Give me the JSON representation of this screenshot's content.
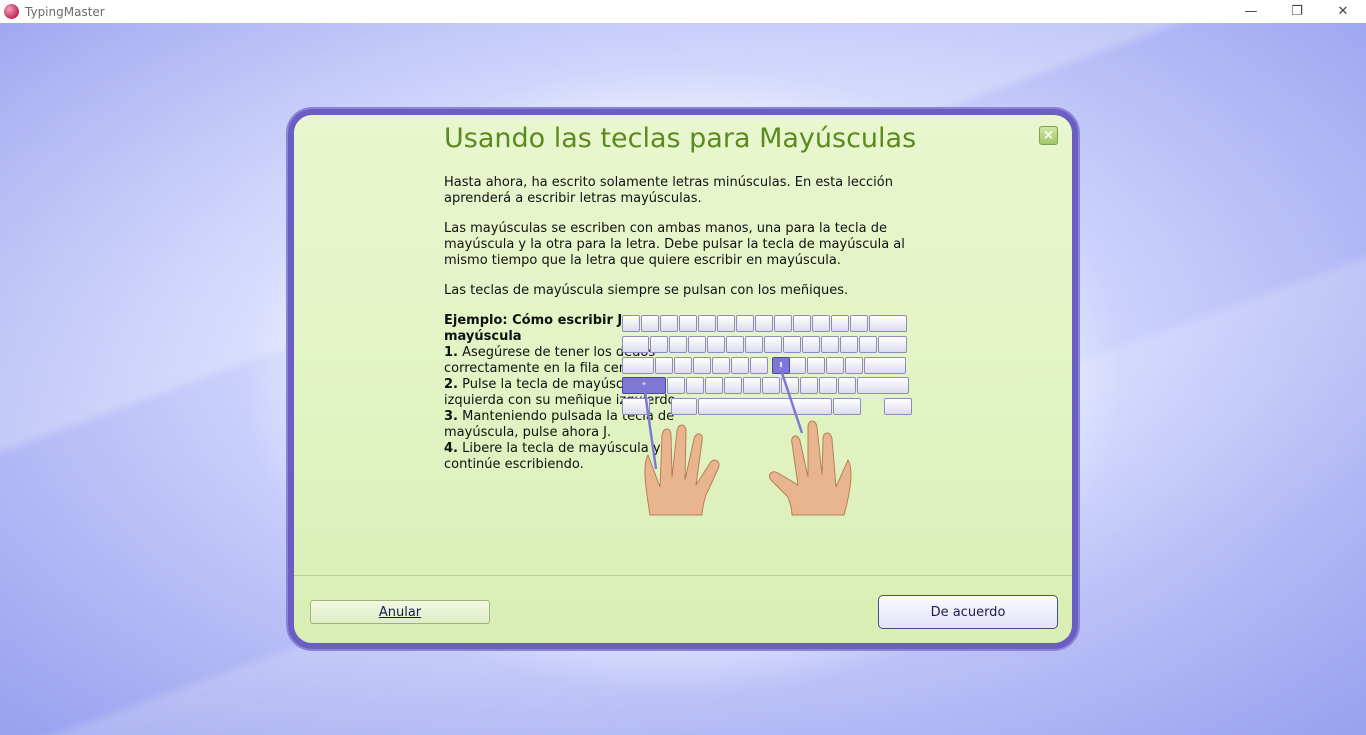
{
  "window": {
    "title": "TypingMaster",
    "minimize": "—",
    "restore": "❐",
    "close": "✕"
  },
  "dialog": {
    "title": "Usando las teclas para Mayúsculas",
    "close_glyph": "×",
    "paragraphs": [
      "Hasta ahora, ha escrito solamente letras minúsculas. En esta lección aprenderá a escribir letras mayúsculas.",
      "Las mayúsculas se escriben con ambas manos, una para la tecla de mayúscula y la otra para la letra. Debe pulsar la tecla de mayúscula al mismo tiempo que la letra que quiere escribir en mayúscula.",
      "Las teclas de mayúscula siempre se pulsan con los meñiques."
    ],
    "example_heading": "Ejemplo: Cómo escribir J mayúscula",
    "steps": [
      {
        "num": "1.",
        "text": "Asegúrese de tener los dedos correctamente en la fila central."
      },
      {
        "num": "2.",
        "text": "Pulse la tecla de mayúscula izquierda con su meñique izquierdo."
      },
      {
        "num": "3.",
        "text": "Manteniendo pulsada la tecla de mayúscula, pulse ahora J."
      },
      {
        "num": "4.",
        "text": "Libere la tecla de mayúscula y continúe escribiendo."
      }
    ],
    "keyboard": {
      "highlight_key": "J",
      "shift_glyph": "⇧",
      "highlight_color": "#7f77d4"
    },
    "buttons": {
      "cancel": "Anular",
      "ok": "De acuerdo"
    }
  }
}
